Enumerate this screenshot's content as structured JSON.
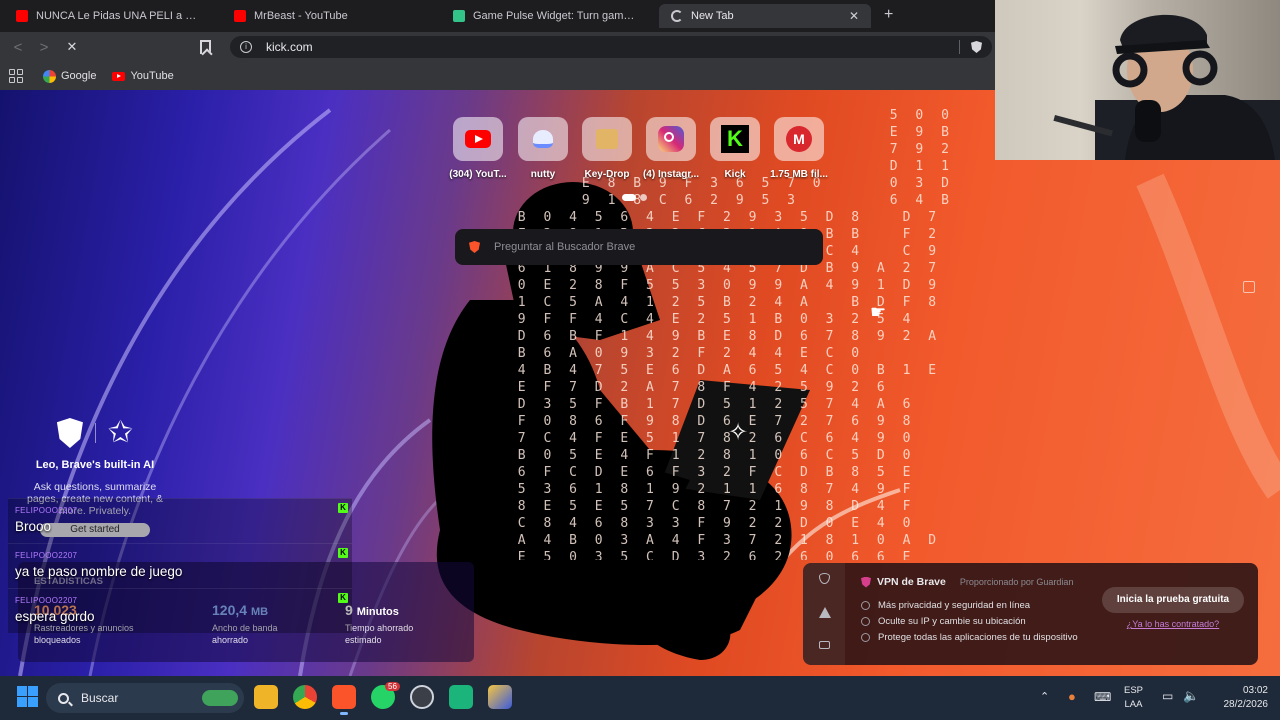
{
  "tabs": [
    {
      "label": "NUNCA Le Pidas UNA PELI a Santutu",
      "icon": "youtube-icon",
      "color": "#ff0000"
    },
    {
      "label": "MrBeast - YouTube",
      "icon": "youtube-icon",
      "color": "#ff0000"
    },
    {
      "label": "Game Pulse Widget: Turn gameplay",
      "icon": "widget-icon",
      "color": "#33c48a"
    },
    {
      "label": "New Tab",
      "icon": "loading-icon",
      "color": "#c9c9cf"
    }
  ],
  "address": {
    "url": "kick.com"
  },
  "bookmarks": [
    {
      "label": "Google",
      "icon": "google-icon"
    },
    {
      "label": "YouTube",
      "icon": "youtube-icon"
    }
  ],
  "top_sites": [
    {
      "label": "(304) YouT...",
      "icon": "youtube-icon",
      "color": "#ff0000"
    },
    {
      "label": "nutty",
      "icon": "nutty-icon",
      "color": "#6b8cff"
    },
    {
      "label": "Key-Drop",
      "icon": "keydrop-icon",
      "color": "#e5b84a"
    },
    {
      "label": "(4) Instagr...",
      "icon": "instagram-icon",
      "color": "#d62976"
    },
    {
      "label": "Kick",
      "icon": "kick-icon",
      "color": "#53fc18"
    },
    {
      "label": "1.75 MB fil...",
      "icon": "mega-icon",
      "color": "#d9272e"
    }
  ],
  "search": {
    "placeholder": "Preguntar al Buscador Brave"
  },
  "leo": {
    "title": "Leo, Brave's built-in AI",
    "description": "Ask questions, summarize pages, create new content, & more. Privately.",
    "button": "Get started"
  },
  "stats": {
    "header": "ESTADÍSTICAS",
    "trackers": {
      "value": "10,023",
      "label": "Rastreadores y anuncios bloqueados"
    },
    "bandwidth": {
      "value": "120,4",
      "unit": "MB",
      "label": "Ancho de banda ahorrado"
    },
    "time": {
      "value": "9",
      "unit": "Minutos",
      "label": "Tiempo ahorrado estimado"
    }
  },
  "chat": [
    {
      "user": "FELIPOOO2207",
      "text": "Brooo"
    },
    {
      "user": "FELIPOOO2207",
      "text": "ya te paso nombre de juego"
    },
    {
      "user": "FELIPOOO2207",
      "text": "espera gordo"
    }
  ],
  "vpn": {
    "title": "VPN de Brave",
    "provider": "Proporcionado por Guardian",
    "features": [
      "Más privacidad y seguridad en línea",
      "Oculte su IP y cambie su ubicación",
      "Protege todas las aplicaciones de tu dispositivo"
    ],
    "cta": "Inicia la prueba gratuita",
    "link": "¿Ya lo has contratado?"
  },
  "taskbar": {
    "search_placeholder": "Buscar",
    "whatsapp_badge": "56",
    "language": "ESP",
    "layout": "LAA",
    "time": "03:02",
    "date": "28/2/2026"
  },
  "colors": {
    "accent_brave": "#fb542b",
    "kick_green": "#53fc18",
    "vpn_accent": "#d63f8c"
  }
}
